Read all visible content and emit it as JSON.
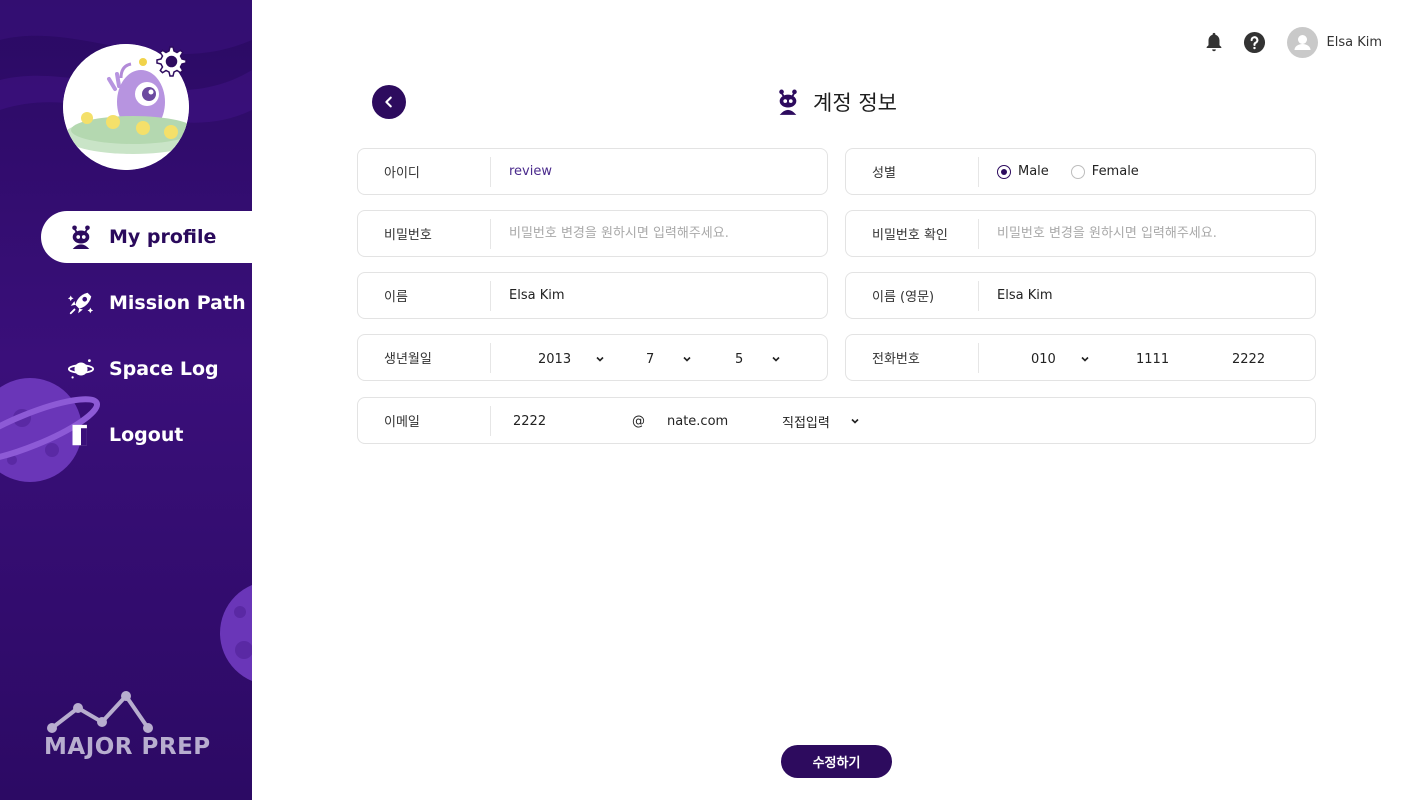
{
  "sidebar": {
    "items": [
      {
        "label": "My profile",
        "icon": "alien-icon",
        "active": true
      },
      {
        "label": "Mission Path",
        "icon": "rocket-icon",
        "active": false
      },
      {
        "label": "Space Log",
        "icon": "planet-icon",
        "active": false
      },
      {
        "label": "Logout",
        "icon": "door-icon",
        "active": false
      }
    ],
    "brand": "MAJOR PREP"
  },
  "header": {
    "user_name": "Elsa Kim",
    "icons": [
      "bell-icon",
      "help-icon",
      "avatar"
    ]
  },
  "page": {
    "title": "계정 정보",
    "back_icon": "chevron-left-icon"
  },
  "form": {
    "id": {
      "label": "아이디",
      "value": "review"
    },
    "gender": {
      "label": "성별",
      "options": [
        "Male",
        "Female"
      ],
      "selected": "Male"
    },
    "password": {
      "label": "비밀번호",
      "placeholder": "비밀번호 변경을 원하시면 입력해주세요."
    },
    "password_confirm": {
      "label": "비밀번호 확인",
      "placeholder": "비밀번호 변경을 원하시면 입력해주세요."
    },
    "name": {
      "label": "이름",
      "value": "Elsa Kim"
    },
    "name_en": {
      "label": "이름 (영문)",
      "value": "Elsa Kim"
    },
    "birthdate": {
      "label": "생년월일",
      "year": "2013",
      "month": "7",
      "day": "5"
    },
    "phone": {
      "label": "전화번호",
      "prefix": "010",
      "middle": "1111",
      "last": "2222"
    },
    "email": {
      "label": "이메일",
      "local": "2222",
      "at": "@",
      "domain": "nate.com",
      "domain_select": "직접입력"
    }
  },
  "submit_label": "수정하기",
  "colors": {
    "primary": "#2d0b5e",
    "sidebar": "#3a0f7a",
    "id_value": "#4a2a8c",
    "placeholder": "#a9a9a9"
  }
}
